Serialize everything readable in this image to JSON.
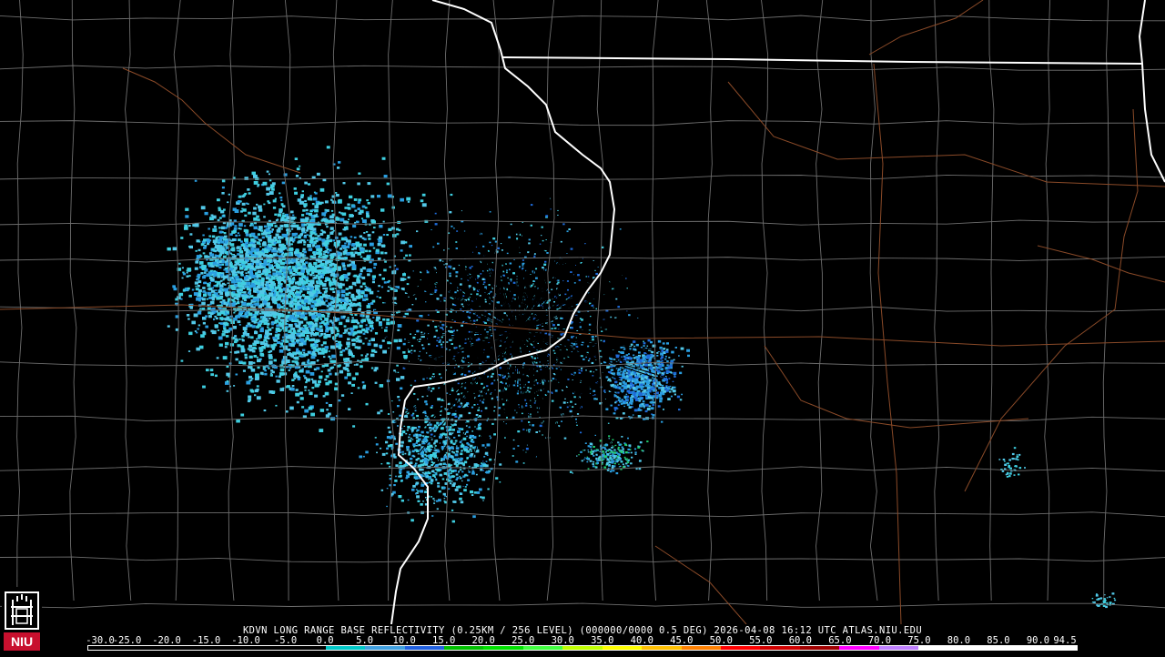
{
  "caption": "KDVN LONG RANGE BASE REFLECTIVITY (0.25KM / 256 LEVEL) (000000/0000 0.5 DEG) 2026-04-08 16:12 UTC  ATLAS.NIU.EDU",
  "logo": {
    "text": "NIU",
    "icon": "niu-castle-logo-icon",
    "color": "#c8102e"
  },
  "scale": {
    "labels": [
      "-30.0",
      "-25.0",
      "-20.0",
      "-15.0",
      "-10.0",
      "-5.0",
      "0.0",
      "5.0",
      "10.0",
      "15.0",
      "20.0",
      "25.0",
      "30.0",
      "35.0",
      "40.0",
      "45.0",
      "50.0",
      "55.0",
      "60.0",
      "65.0",
      "70.0",
      "75.0",
      "80.0",
      "85.0",
      "90.0",
      "94.5"
    ],
    "colors": [
      "#000000",
      "#000000",
      "#000000",
      "#000000",
      "#000000",
      "#000000",
      "#00c8c8",
      "#40a0e0",
      "#2060e0",
      "#00c000",
      "#00e000",
      "#40ff40",
      "#c0ff00",
      "#ffff00",
      "#ffc000",
      "#ff8000",
      "#ff0000",
      "#d00000",
      "#a00000",
      "#ff00ff",
      "#c080ff",
      "#ffffff",
      "#ffffff",
      "#ffffff",
      "#ffffff"
    ]
  },
  "map": {
    "background": "#000000",
    "county_line_color": "#6e6e6e",
    "state_line_color": "#ffffff",
    "road_color": "#8a4a28",
    "echo_colors": [
      "#3ecfe0",
      "#52c8e8",
      "#2a9ee0",
      "#1e6ad8",
      "#20d070"
    ]
  }
}
